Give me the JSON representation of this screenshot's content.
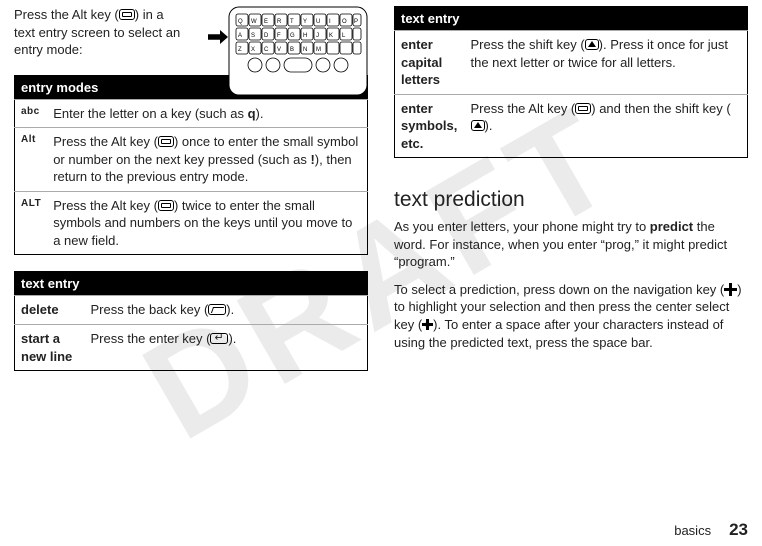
{
  "watermark": "DRAFT",
  "left": {
    "intro": "Press the Alt key ( ALT ) in a text entry screen to select an entry mode:",
    "entry_modes_header": "entry modes",
    "modes": [
      {
        "label": "abc",
        "desc_pre": "Enter the letter on a key (such as ",
        "bold": "q",
        "desc_post": ")."
      },
      {
        "label": "Alt",
        "desc_pre": "Press the Alt key ( ALT ) once to enter the small symbol or number on the next key pressed (such as ",
        "bold": "!",
        "desc_post": "), then return to the previous entry mode."
      },
      {
        "label": "ALT",
        "desc_pre": "Press the Alt key ( ALT ) twice to enter the small symbols and numbers on the keys until you move to a new field.",
        "bold": "",
        "desc_post": ""
      }
    ],
    "text_entry_header": "text entry",
    "actions": [
      {
        "action": "delete",
        "desc": "Press the back key ( BACK )."
      },
      {
        "action": "start a new line",
        "desc": "Press the enter key ( ENTER )."
      }
    ]
  },
  "right": {
    "text_entry_header": "text entry",
    "actions": [
      {
        "action": "enter capital letters",
        "desc": "Press the shift key ( SHIFT ). Press it once for just the next letter or twice for all letters."
      },
      {
        "action": "enter symbols, etc.",
        "desc": "Press the Alt key ( ALT ) and then the shift key ( SHIFT )."
      }
    ],
    "heading": "text prediction",
    "p1_pre": "As you enter letters, your phone might try to ",
    "p1_bold": "predict",
    "p1_post": " the word. For instance, when you enter “prog,” it might predict “program.”",
    "p2": "To select a prediction, press down on the navigation key ( NAV ) to highlight your selection and then press the center select key ( CENTER ). To enter a space after your characters instead of using the predicted text, press the space bar."
  },
  "footer": {
    "section": "basics",
    "page": "23"
  }
}
